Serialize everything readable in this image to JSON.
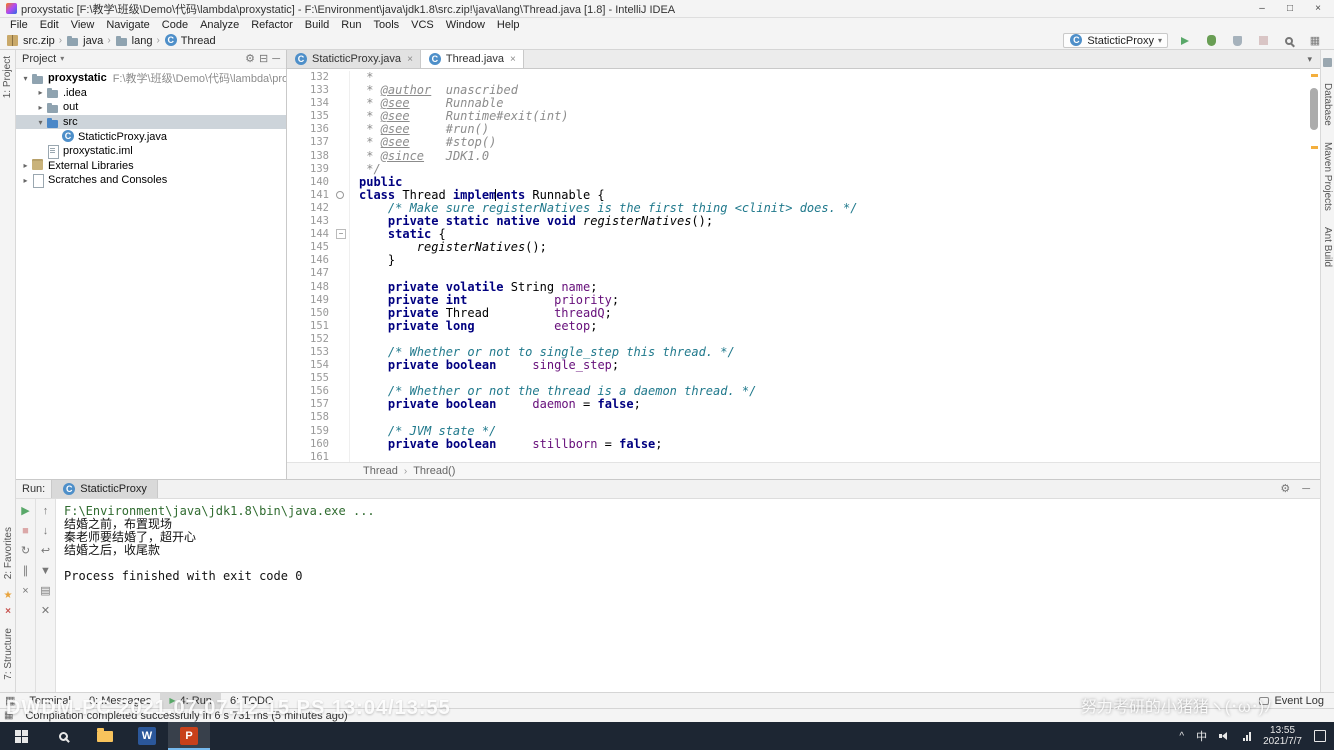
{
  "title_bar": {
    "title": "proxystatic [F:\\教学\\班级\\Demo\\代码\\lambda\\proxystatic] - F:\\Environment\\java\\jdk1.8\\src.zip!\\java\\lang\\Thread.java [1.8] - IntelliJ IDEA"
  },
  "menu_bar": {
    "items": [
      "File",
      "Edit",
      "View",
      "Navigate",
      "Code",
      "Analyze",
      "Refactor",
      "Build",
      "Run",
      "Tools",
      "VCS",
      "Window",
      "Help"
    ]
  },
  "navbar": {
    "crumbs": [
      {
        "label": "src.zip",
        "icon": "archive"
      },
      {
        "label": "java",
        "icon": "folder"
      },
      {
        "label": "lang",
        "icon": "folder"
      },
      {
        "label": "Thread",
        "icon": "class"
      }
    ],
    "run_config": "StaticticProxy"
  },
  "left_stripe": {
    "top": "1: Project",
    "favorites": "2: Favorites",
    "structure": "7: Structure"
  },
  "right_stripe": {
    "items": [
      "Database",
      "Maven Projects",
      "Ant Build"
    ]
  },
  "project": {
    "header": "Project",
    "tree": [
      {
        "label": "proxystatic",
        "path": "F:\\教学\\班级\\Demo\\代码\\lambda\\proxystatic",
        "indent": 0,
        "arrow": "down",
        "icon": "folder",
        "bold": true
      },
      {
        "label": ".idea",
        "indent": 1,
        "arrow": "right",
        "icon": "folder"
      },
      {
        "label": "out",
        "indent": 1,
        "arrow": "right",
        "icon": "folder"
      },
      {
        "label": "src",
        "indent": 1,
        "arrow": "down",
        "icon": "folder-src",
        "selected": true
      },
      {
        "label": "StaticticProxy.java",
        "indent": 2,
        "arrow": "none",
        "icon": "class"
      },
      {
        "label": "proxystatic.iml",
        "indent": 1,
        "arrow": "none",
        "icon": "file"
      },
      {
        "label": "External Libraries",
        "indent": 0,
        "arrow": "right",
        "icon": "lib"
      },
      {
        "label": "Scratches and Consoles",
        "indent": 0,
        "arrow": "right",
        "icon": "scratch"
      }
    ]
  },
  "editor": {
    "tabs": [
      {
        "label": "StaticticProxy.java",
        "active": false
      },
      {
        "label": "Thread.java",
        "active": true
      }
    ],
    "breadcrumbs": [
      "Thread",
      "Thread()"
    ],
    "code": [
      {
        "n": 132,
        "seg": [
          [
            "doc",
            " *"
          ]
        ]
      },
      {
        "n": 133,
        "seg": [
          [
            "doc",
            " * "
          ],
          [
            "tag",
            "@author"
          ],
          [
            "doc",
            "  unascribed"
          ]
        ]
      },
      {
        "n": 134,
        "seg": [
          [
            "doc",
            " * "
          ],
          [
            "tag",
            "@see"
          ],
          [
            "doc",
            "     Runnable"
          ]
        ]
      },
      {
        "n": 135,
        "seg": [
          [
            "doc",
            " * "
          ],
          [
            "tag",
            "@see"
          ],
          [
            "doc",
            "     Runtime#exit(int)"
          ]
        ]
      },
      {
        "n": 136,
        "seg": [
          [
            "doc",
            " * "
          ],
          [
            "tag",
            "@see"
          ],
          [
            "doc",
            "     #run()"
          ]
        ]
      },
      {
        "n": 137,
        "seg": [
          [
            "doc",
            " * "
          ],
          [
            "tag",
            "@see"
          ],
          [
            "doc",
            "     #stop()"
          ]
        ]
      },
      {
        "n": 138,
        "seg": [
          [
            "doc",
            " * "
          ],
          [
            "tag",
            "@since"
          ],
          [
            "doc",
            "   JDK1.0"
          ]
        ]
      },
      {
        "n": 139,
        "seg": [
          [
            "doc",
            " */"
          ]
        ]
      },
      {
        "n": 140,
        "seg": [
          [
            "kw",
            "public"
          ]
        ]
      },
      {
        "n": 141,
        "marker": true,
        "seg": [
          [
            "kw",
            "class"
          ],
          [
            "pl",
            " Thread "
          ],
          [
            "kw",
            "implem"
          ],
          [
            "caret",
            ""
          ],
          [
            "kw",
            "ents"
          ],
          [
            "pl",
            " Runnable {"
          ]
        ]
      },
      {
        "n": 142,
        "seg": [
          [
            "pl",
            "    "
          ],
          [
            "cmt",
            "/* Make sure registerNatives is the first thing <clinit> does. */"
          ]
        ]
      },
      {
        "n": 143,
        "seg": [
          [
            "pl",
            "    "
          ],
          [
            "kw",
            "private"
          ],
          [
            "pl",
            " "
          ],
          [
            "kw",
            "static"
          ],
          [
            "pl",
            " "
          ],
          [
            "kw",
            "native"
          ],
          [
            "pl",
            " "
          ],
          [
            "kw",
            "void"
          ],
          [
            "pl",
            " "
          ],
          [
            "st",
            "registerNatives"
          ],
          [
            "pl",
            "();"
          ]
        ]
      },
      {
        "n": 144,
        "fold": true,
        "seg": [
          [
            "pl",
            "    "
          ],
          [
            "kw",
            "static"
          ],
          [
            "pl",
            " {"
          ]
        ]
      },
      {
        "n": 145,
        "seg": [
          [
            "pl",
            "        "
          ],
          [
            "st",
            "registerNatives"
          ],
          [
            "pl",
            "();"
          ]
        ]
      },
      {
        "n": 146,
        "seg": [
          [
            "pl",
            "    }"
          ]
        ]
      },
      {
        "n": 147,
        "seg": []
      },
      {
        "n": 148,
        "seg": [
          [
            "pl",
            "    "
          ],
          [
            "kw",
            "private"
          ],
          [
            "pl",
            " "
          ],
          [
            "kw",
            "volatile"
          ],
          [
            "pl",
            " String "
          ],
          [
            "fld",
            "name"
          ],
          [
            "pl",
            ";"
          ]
        ]
      },
      {
        "n": 149,
        "seg": [
          [
            "pl",
            "    "
          ],
          [
            "kw",
            "private"
          ],
          [
            "pl",
            " "
          ],
          [
            "kw",
            "int"
          ],
          [
            "pl",
            "            "
          ],
          [
            "fld",
            "priority"
          ],
          [
            "pl",
            ";"
          ]
        ]
      },
      {
        "n": 150,
        "seg": [
          [
            "pl",
            "    "
          ],
          [
            "kw",
            "private"
          ],
          [
            "pl",
            " Thread         "
          ],
          [
            "fld",
            "threadQ"
          ],
          [
            "pl",
            ";"
          ]
        ]
      },
      {
        "n": 151,
        "seg": [
          [
            "pl",
            "    "
          ],
          [
            "kw",
            "private"
          ],
          [
            "pl",
            " "
          ],
          [
            "kw",
            "long"
          ],
          [
            "pl",
            "           "
          ],
          [
            "fld",
            "eetop"
          ],
          [
            "pl",
            ";"
          ]
        ]
      },
      {
        "n": 152,
        "seg": []
      },
      {
        "n": 153,
        "seg": [
          [
            "pl",
            "    "
          ],
          [
            "cmt",
            "/* Whether or not to single_step this thread. */"
          ]
        ]
      },
      {
        "n": 154,
        "seg": [
          [
            "pl",
            "    "
          ],
          [
            "kw",
            "private"
          ],
          [
            "pl",
            " "
          ],
          [
            "kw",
            "boolean"
          ],
          [
            "pl",
            "     "
          ],
          [
            "fld",
            "single_step"
          ],
          [
            "pl",
            ";"
          ]
        ]
      },
      {
        "n": 155,
        "seg": []
      },
      {
        "n": 156,
        "seg": [
          [
            "pl",
            "    "
          ],
          [
            "cmt",
            "/* Whether or not the thread is a daemon thread. */"
          ]
        ]
      },
      {
        "n": 157,
        "seg": [
          [
            "pl",
            "    "
          ],
          [
            "kw",
            "private"
          ],
          [
            "pl",
            " "
          ],
          [
            "kw",
            "boolean"
          ],
          [
            "pl",
            "     "
          ],
          [
            "fld",
            "daemon"
          ],
          [
            "pl",
            " = "
          ],
          [
            "kw",
            "false"
          ],
          [
            "pl",
            ";"
          ]
        ]
      },
      {
        "n": 158,
        "seg": []
      },
      {
        "n": 159,
        "seg": [
          [
            "pl",
            "    "
          ],
          [
            "cmt",
            "/* JVM state */"
          ]
        ]
      },
      {
        "n": 160,
        "seg": [
          [
            "pl",
            "    "
          ],
          [
            "kw",
            "private"
          ],
          [
            "pl",
            " "
          ],
          [
            "kw",
            "boolean"
          ],
          [
            "pl",
            "     "
          ],
          [
            "fld",
            "stillborn"
          ],
          [
            "pl",
            " = "
          ],
          [
            "kw",
            "false"
          ],
          [
            "pl",
            ";"
          ]
        ]
      },
      {
        "n": 161,
        "seg": []
      }
    ]
  },
  "run_panel": {
    "label": "Run:",
    "tab": "StaticticProxy",
    "toolbar_left": [
      {
        "name": "rerun-button",
        "glyph": "▶",
        "cls": "g-green"
      },
      {
        "name": "stop-button",
        "glyph": "■",
        "cls": "g-redmuted"
      },
      {
        "name": "restart-button",
        "glyph": "↻",
        "cls": ""
      },
      {
        "name": "pause-button",
        "glyph": "∥",
        "cls": ""
      },
      {
        "name": "close-button",
        "glyph": "×",
        "cls": ""
      }
    ],
    "toolbar_inner": [
      {
        "name": "up-stacktrace-button",
        "glyph": "↑",
        "cls": ""
      },
      {
        "name": "down-stacktrace-button",
        "glyph": "↓",
        "cls": ""
      },
      {
        "name": "soft-wrap-button",
        "glyph": "↩",
        "cls": ""
      },
      {
        "name": "scroll-to-end-button",
        "glyph": "▼",
        "cls": ""
      },
      {
        "name": "print-button",
        "glyph": "▤",
        "cls": ""
      },
      {
        "name": "clear-all-button",
        "glyph": "✕",
        "cls": ""
      }
    ],
    "console": [
      {
        "text": "F:\\Environment\\java\\jdk1.8\\bin\\java.exe ...",
        "style": "cmd"
      },
      {
        "text": "结婚之前，布置现场",
        "style": "out"
      },
      {
        "text": "秦老师要结婚了，超开心",
        "style": "out"
      },
      {
        "text": "结婚之后，收尾款",
        "style": "out"
      },
      {
        "text": "",
        "style": "out"
      },
      {
        "text": "Process finished with exit code 0",
        "style": "out"
      }
    ]
  },
  "bottom_bar": {
    "items": [
      {
        "label": "Terminal",
        "active": false
      },
      {
        "label": "0: Messages",
        "active": false
      },
      {
        "label": "4: Run",
        "active": true
      },
      {
        "label": "6: TODO",
        "active": false
      }
    ],
    "right": "Event Log"
  },
  "status_bar": {
    "message": "Compilation completed successfully in 6 s 731 ms (5 minutes ago)"
  },
  "watermarks": {
    "recorder": "DWDM-PC 2021.07.07.12.15.PS 13:04/13:55",
    "channel": "努力考研的小猪猪ヽ(･ω･)ﾉ"
  },
  "taskbar": {
    "ime": "中",
    "clock_time": "13:55",
    "clock_date": "2021/7/7",
    "apps": [
      {
        "name": "start-button",
        "type": "start"
      },
      {
        "name": "search-button",
        "type": "search"
      },
      {
        "name": "file-explorer-icon",
        "type": "folder"
      },
      {
        "name": "word-icon",
        "type": "tile-blue",
        "letter": "W",
        "active": false
      },
      {
        "name": "powerpoint-icon",
        "type": "tile-orange",
        "letter": "P",
        "active": true
      }
    ]
  }
}
